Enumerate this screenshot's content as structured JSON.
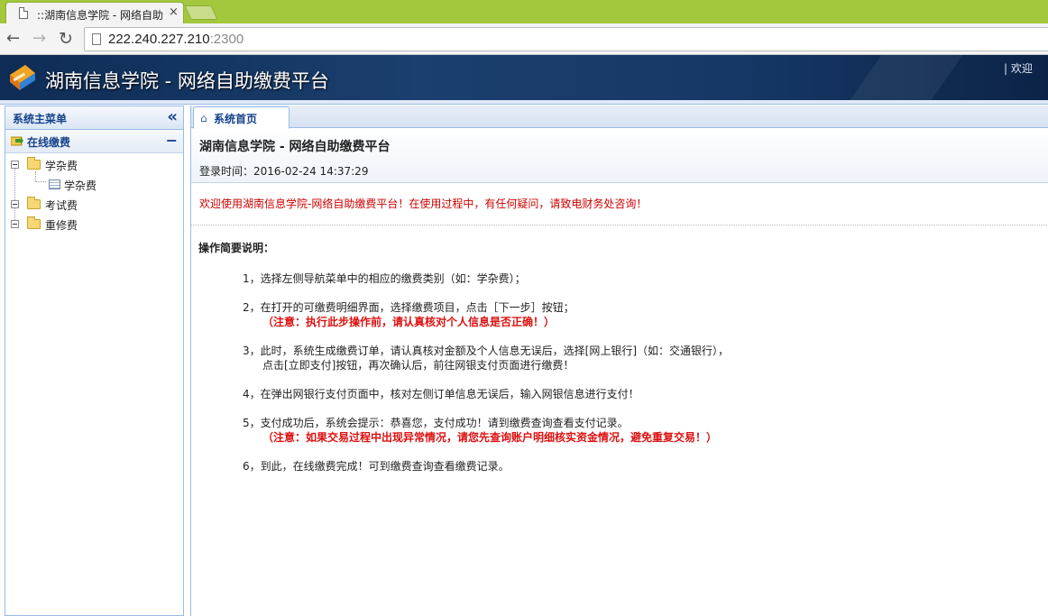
{
  "browser": {
    "tab_title": "::湖南信息学院 - 网络自助",
    "tab_close": "×",
    "url_host": "222.240.227.210",
    "url_port": ":2300"
  },
  "header": {
    "title": "湖南信息学院 - 网络自助缴费平台",
    "welcome": "| 欢迎"
  },
  "sidebar": {
    "title": "系统主菜单",
    "section": "在线缴费",
    "tree": [
      {
        "label": "学杂费"
      },
      {
        "label": "学杂费"
      },
      {
        "label": "考试费"
      },
      {
        "label": "重修费"
      }
    ]
  },
  "main": {
    "tab_home": "系统首页",
    "heading": "湖南信息学院 - 网络自助缴费平台",
    "login_time": "登录时间：2016-02-24 14:37:29",
    "notice": "欢迎使用湖南信息学院-网络自助缴费平台！在使用过程中，有任何疑问，请致电财务处咨询！",
    "guide_title": "操作简要说明：",
    "steps": [
      {
        "text": "1，选择左侧导航菜单中的相应的缴费类别（如：学杂费）；"
      },
      {
        "text": "2，在打开的可缴费明细界面，选择缴费项目，点击［下一步］按钮；",
        "warn": "（注意：执行此步操作前，请认真核对个人信息是否正确！）"
      },
      {
        "text": "3，此时，系统生成缴费订单，请认真核对金额及个人信息无误后，选择[网上银行]（如：交通银行），",
        "sub": "点击[立即支付]按钮，再次确认后，前往网银支付页面进行缴费！"
      },
      {
        "text": "4，在弹出网银行支付页面中，核对左侧订单信息无误后，输入网银信息进行支付！"
      },
      {
        "text": "5，支付成功后，系统会提示：恭喜您，支付成功！请到缴费查询查看支付记录。",
        "warn": "（注意：如果交易过程中出现异常情况，请您先查询账户明细核实资金情况，避免重复交易！）"
      },
      {
        "text": "6，到此，在线缴费完成！可到缴费查询查看缴费记录。"
      }
    ]
  },
  "colors": {
    "accent": "#15428b",
    "banner": "#1b3f6e",
    "notice": "#cc0000",
    "warning": "#dd1111",
    "browser_frame": "#a3c73d"
  },
  "icons": {
    "back": "back-arrow-icon",
    "forward": "forward-arrow-icon",
    "reload": "reload-icon",
    "collapse": "double-chevron-left-icon",
    "home": "home-icon",
    "folder": "folder-icon",
    "grid": "grid-icon"
  }
}
